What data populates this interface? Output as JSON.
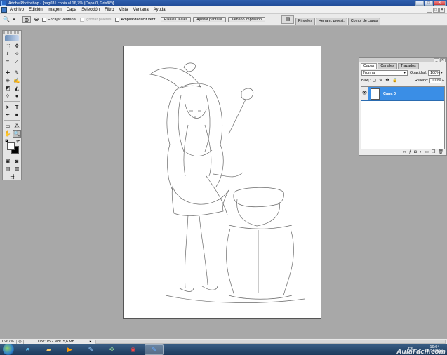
{
  "window": {
    "title": "Adobe Photoshop - [pag031 copia al 16,7% (Capa 0, Gris/8*)]",
    "controls": [
      "_",
      "□",
      "✕"
    ]
  },
  "menu": {
    "items": [
      "Archivo",
      "Edición",
      "Imagen",
      "Capa",
      "Selección",
      "Filtro",
      "Vista",
      "Ventana",
      "Ayuda"
    ],
    "doc_controls": [
      "_",
      "□",
      "✕"
    ]
  },
  "options": {
    "tool_icon": "zoom-icon",
    "checkboxes": [
      {
        "label": "Encajar ventana",
        "checked": false,
        "enabled": true
      },
      {
        "label": "Ignorar paletas",
        "checked": false,
        "enabled": false
      },
      {
        "label": "Ampliar/reducir vent.",
        "checked": false,
        "enabled": true
      }
    ],
    "buttons": [
      "Píxeles reales",
      "Ajustar pantalla",
      "Tamaño impresión"
    ],
    "well_tabs": [
      "Pinceles",
      "Herram. preest.",
      "Comp. de capas"
    ]
  },
  "layers_panel": {
    "tabs": [
      "Capas",
      "Canales",
      "Trazados"
    ],
    "blend_mode": "Normal",
    "opacity_label": "Opacidad:",
    "opacity_value": "100%",
    "lock_label": "Bloq.:",
    "fill_label": "Relleno:",
    "fill_value": "100%",
    "layers": [
      {
        "name": "Capa 0",
        "visible": true,
        "selected": true
      }
    ],
    "bottom_icons": [
      "link-icon",
      "fx-icon",
      "mask-icon",
      "adjustment-icon",
      "folder-icon",
      "new-layer-icon",
      "trash-icon"
    ]
  },
  "status": {
    "zoom": "16,67%",
    "doc_size": "Doc: 15,2 MB/15,6 MB"
  },
  "taskbar": {
    "apps": [
      "internet-explorer-icon",
      "file-explorer-icon",
      "media-player-icon",
      "paint-icon",
      "network-icon",
      "chrome-icon",
      "photoshop-icon"
    ],
    "language": "ES",
    "time": "19:04",
    "date": "28/10/2011"
  },
  "watermark": "AulaFacil.com"
}
